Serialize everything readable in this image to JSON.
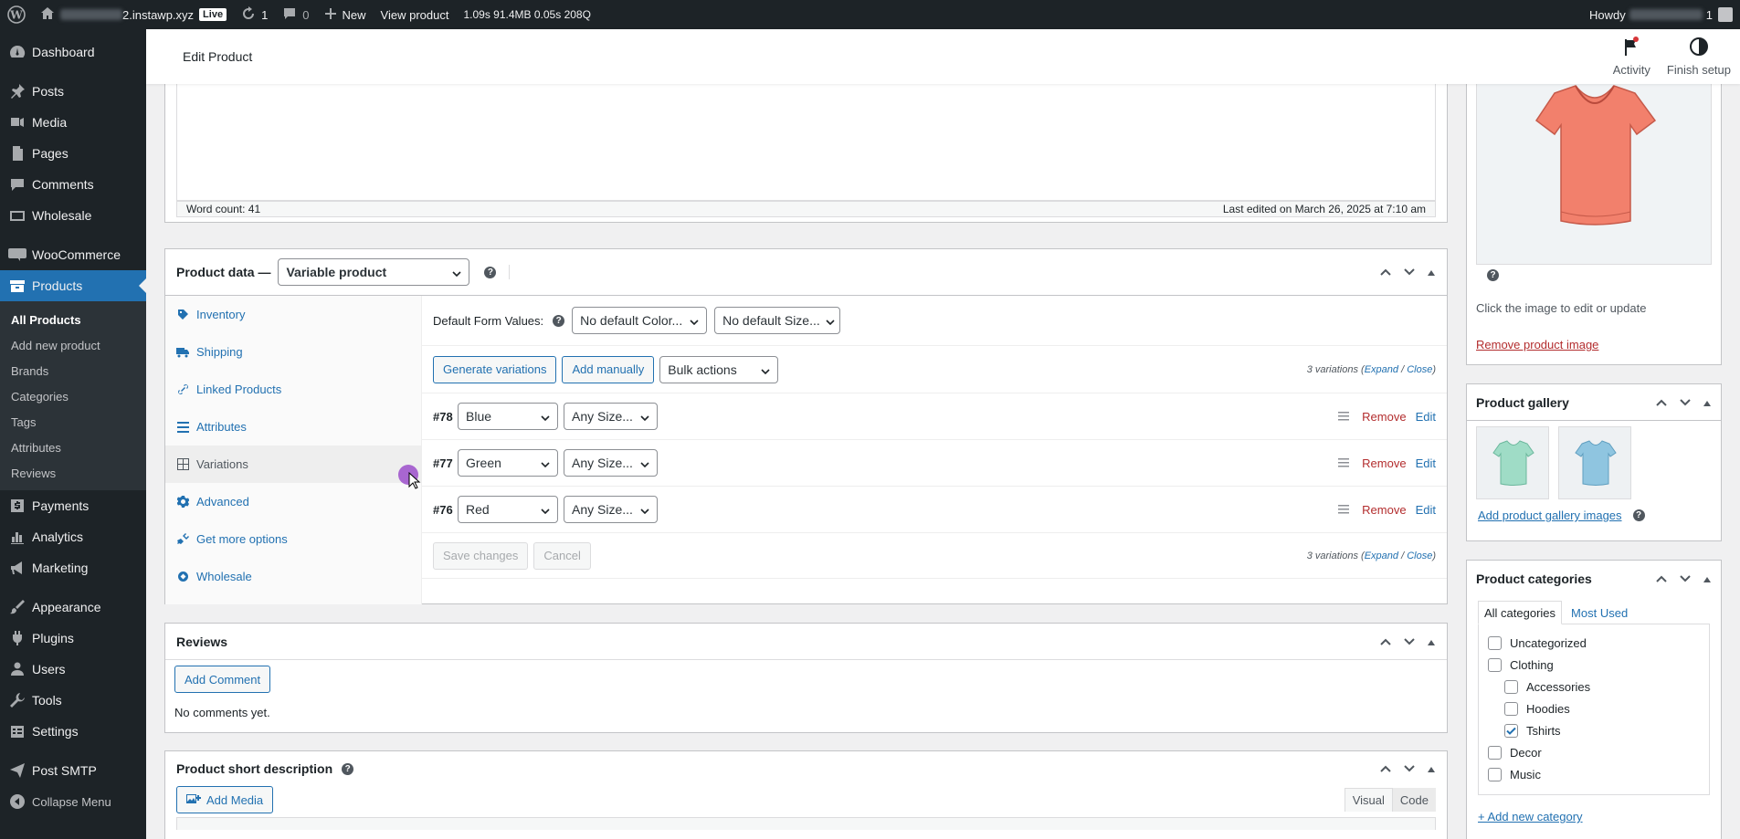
{
  "adminbar": {
    "site_suffix": "2.instawp.xyz",
    "live_badge": "Live",
    "updates_count": "1",
    "comments_count": "0",
    "new_label": "New",
    "view_product": "View product",
    "perf_time": "1.09s",
    "perf_mem": "91.4MB",
    "perf_q": "0.05s",
    "perf_count": "208Q",
    "howdy": "Howdy",
    "notif_count": "1"
  },
  "sidebar": {
    "items": [
      {
        "label": "Dashboard",
        "icon": "dashboard-icon"
      },
      {
        "label": "Posts",
        "icon": "pin-icon"
      },
      {
        "label": "Media",
        "icon": "media-icon"
      },
      {
        "label": "Pages",
        "icon": "pages-icon"
      },
      {
        "label": "Comments",
        "icon": "comment-icon"
      },
      {
        "label": "Wholesale",
        "icon": "wholesale-icon"
      },
      {
        "label": "WooCommerce",
        "icon": "woo-icon"
      },
      {
        "label": "Products",
        "icon": "archive-icon"
      }
    ],
    "products_sub": [
      "All Products",
      "Add new product",
      "Brands",
      "Categories",
      "Tags",
      "Attributes",
      "Reviews"
    ],
    "items2": [
      {
        "label": "Payments",
        "icon": "payments-icon"
      },
      {
        "label": "Analytics",
        "icon": "analytics-icon"
      },
      {
        "label": "Marketing",
        "icon": "megaphone-icon"
      },
      {
        "label": "Appearance",
        "icon": "brush-icon"
      },
      {
        "label": "Plugins",
        "icon": "plugin-icon"
      },
      {
        "label": "Users",
        "icon": "users-icon"
      },
      {
        "label": "Tools",
        "icon": "wrench-icon"
      },
      {
        "label": "Settings",
        "icon": "settings-icon"
      },
      {
        "label": "Post SMTP",
        "icon": "send-icon"
      },
      {
        "label": "Collapse Menu",
        "icon": "collapse-icon"
      }
    ]
  },
  "header": {
    "title": "Edit Product",
    "activity": "Activity",
    "finish_setup": "Finish setup"
  },
  "editor": {
    "word_count": "Word count: 41",
    "last_edited": "Last edited on March 26, 2025 at 7:10 am"
  },
  "product_data": {
    "label": "Product data —",
    "type": "Variable product",
    "tabs": [
      "Inventory",
      "Shipping",
      "Linked Products",
      "Attributes",
      "Variations",
      "Advanced",
      "Get more options",
      "Wholesale"
    ],
    "default_form_label": "Default Form Values:",
    "default_color": "No default Color...",
    "default_size": "No default Size...",
    "generate_btn": "Generate variations",
    "add_manually_btn": "Add manually",
    "bulk_actions": "Bulk actions",
    "variations_count": "3 variations",
    "expand": "Expand",
    "close": "Close",
    "variations": [
      {
        "id": "#78",
        "color": "Blue",
        "size": "Any Size..."
      },
      {
        "id": "#77",
        "color": "Green",
        "size": "Any Size..."
      },
      {
        "id": "#76",
        "color": "Red",
        "size": "Any Size..."
      }
    ],
    "remove": "Remove",
    "edit": "Edit",
    "save_changes": "Save changes",
    "cancel": "Cancel"
  },
  "reviews": {
    "title": "Reviews",
    "add_comment": "Add Comment",
    "empty": "No comments yet."
  },
  "short_desc": {
    "title": "Product short description",
    "add_media": "Add Media",
    "visual": "Visual",
    "code": "Code"
  },
  "product_image": {
    "hint": "Click the image to edit or update",
    "remove": "Remove product image"
  },
  "gallery": {
    "title": "Product gallery",
    "add": "Add product gallery images"
  },
  "categories": {
    "title": "Product categories",
    "tab_all": "All categories",
    "tab_most": "Most Used",
    "items": [
      {
        "label": "Uncategorized",
        "checked": false,
        "indent": 0
      },
      {
        "label": "Clothing",
        "checked": false,
        "indent": 0
      },
      {
        "label": "Accessories",
        "checked": false,
        "indent": 1
      },
      {
        "label": "Hoodies",
        "checked": false,
        "indent": 1
      },
      {
        "label": "Tshirts",
        "checked": true,
        "indent": 1
      },
      {
        "label": "Decor",
        "checked": false,
        "indent": 0
      },
      {
        "label": "Music",
        "checked": false,
        "indent": 0
      }
    ],
    "add_new": "+ Add new category"
  },
  "colors": {
    "accent": "#2271b1",
    "sidebar": "#1d2327",
    "danger": "#b32d2e",
    "cursor": "#9b4dca"
  }
}
